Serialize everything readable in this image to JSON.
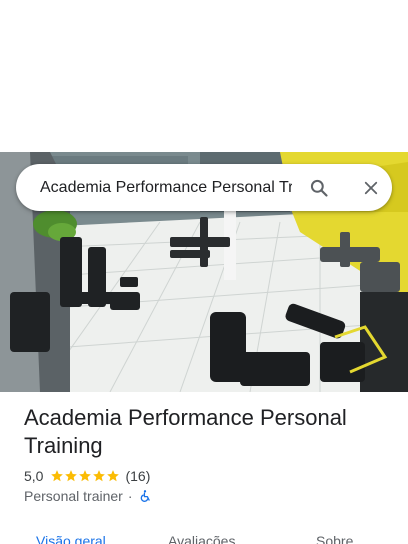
{
  "search": {
    "query": "Academia Performance Personal Training"
  },
  "place": {
    "name": "Academia Performance Personal Training",
    "rating": "5,0",
    "stars": 5,
    "review_count": "(16)",
    "category": "Personal trainer",
    "separator": "·",
    "accessibility_icon": "wheelchair-icon"
  },
  "tabs": [
    {
      "label": "Visão geral",
      "active": true
    },
    {
      "label": "Avaliações",
      "active": false
    },
    {
      "label": "Sobre",
      "active": false
    }
  ],
  "colors": {
    "accent": "#1a73e8",
    "star": "#fbbc04",
    "accessibility": "#1a73e8"
  }
}
